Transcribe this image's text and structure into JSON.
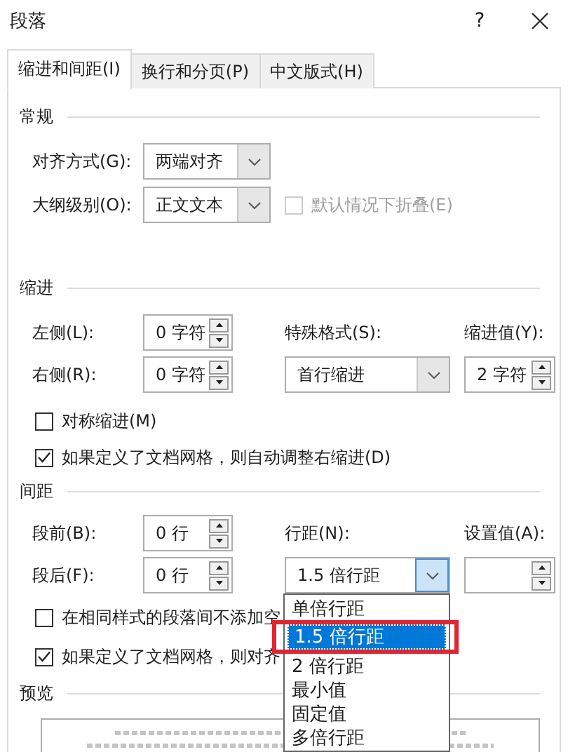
{
  "window": {
    "title": "段落",
    "help": "?"
  },
  "tabs": [
    {
      "label": "缩进和间距(I)",
      "selected": true
    },
    {
      "label": "换行和分页(P)",
      "selected": false
    },
    {
      "label": "中文版式(H)",
      "selected": false
    }
  ],
  "general": {
    "title": "常规",
    "alignment": {
      "label": "对齐方式(G):",
      "value": "两端对齐"
    },
    "outline_level": {
      "label": "大纲级别(O):",
      "value": "正文文本"
    },
    "collapse": {
      "label": "默认情况下折叠(E)",
      "checked": false,
      "disabled": true
    }
  },
  "indent": {
    "title": "缩进",
    "left": {
      "label": "左侧(L):",
      "value": "0 字符"
    },
    "right": {
      "label": "右侧(R):",
      "value": "0 字符"
    },
    "special": {
      "label": "特殊格式(S):",
      "value": "首行缩进"
    },
    "by": {
      "label": "缩进值(Y):",
      "value": "2 字符"
    },
    "checks": [
      {
        "label": "对称缩进(M)",
        "checked": false
      },
      {
        "label": "如果定义了文档网格，则自动调整右缩进(D)",
        "checked": true
      }
    ]
  },
  "spacing": {
    "title": "间距",
    "before": {
      "label": "段前(B):",
      "value": "0 行"
    },
    "after": {
      "label": "段后(F):",
      "value": "0 行"
    },
    "line_spacing": {
      "label": "行距(N):",
      "value": "1.5 倍行距",
      "expanded": true,
      "options": [
        {
          "label": "单倍行距",
          "selected": false
        },
        {
          "label": "1.5 倍行距",
          "selected": true
        },
        {
          "label": "2 倍行距",
          "selected": false
        },
        {
          "label": "最小值",
          "selected": false
        },
        {
          "label": "固定值",
          "selected": false
        },
        {
          "label": "多倍行距",
          "selected": false
        }
      ]
    },
    "at": {
      "label": "设置值(A):"
    },
    "checks": [
      {
        "label": "在相同样式的段落间不添加空",
        "checked": false
      },
      {
        "label": "如果定义了文档网格，则对齐",
        "checked": true
      }
    ]
  },
  "preview": {
    "title": "预览"
  }
}
